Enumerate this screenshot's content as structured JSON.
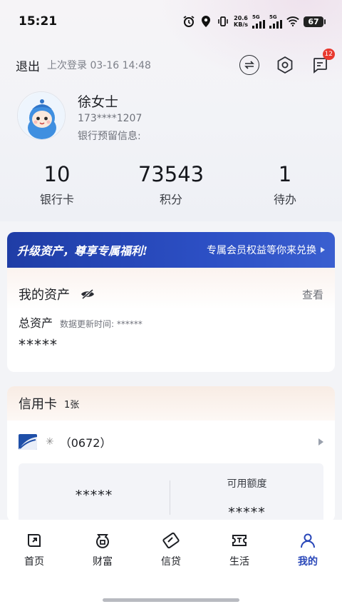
{
  "status_bar": {
    "time": "15:21",
    "net_speed_value": "20.6",
    "net_speed_unit": "KB/s",
    "sim1_label": "5G",
    "sim2_label": "5G",
    "battery": "67",
    "icons": [
      "alarm-icon",
      "location-icon",
      "vibrate-icon",
      "signal-icon",
      "signal-icon",
      "wifi-icon",
      "battery-icon"
    ]
  },
  "header": {
    "logout": "退出",
    "last_login": "上次登录 03-16 14:48",
    "icons": [
      "switch-icon",
      "settings-icon",
      "message-icon"
    ],
    "message_badge": "12"
  },
  "profile": {
    "name": "徐女士",
    "phone": "173****1207",
    "bank_info_label": "银行预留信息:"
  },
  "stats": [
    {
      "value": "10",
      "label": "银行卡"
    },
    {
      "value": "73543",
      "label": "积分"
    },
    {
      "value": "1",
      "label": "待办"
    }
  ],
  "banner": {
    "title": "升级资产，尊享专属福利!",
    "subtitle": "专属会员权益等你来兑换"
  },
  "assets": {
    "title": "我的资产",
    "view_link": "查看",
    "total_label": "总资产",
    "update_time": "数据更新时间: ******",
    "total_value": "*****"
  },
  "credit_card": {
    "title": "信用卡",
    "count": "1张",
    "card_name": "（0672）",
    "left_value": "*****",
    "limit_label": "可用额度",
    "limit_value": "*****"
  },
  "nav": [
    {
      "label": "首页",
      "icon": "home-icon",
      "active": false
    },
    {
      "label": "财富",
      "icon": "wealth-icon",
      "active": false
    },
    {
      "label": "信贷",
      "icon": "credit-icon",
      "active": false
    },
    {
      "label": "生活",
      "icon": "life-icon",
      "active": false
    },
    {
      "label": "我的",
      "icon": "profile-icon",
      "active": true
    }
  ],
  "colors": {
    "accent": "#2846b8",
    "banner": "#2c4fc4",
    "badge": "#e8392f"
  }
}
